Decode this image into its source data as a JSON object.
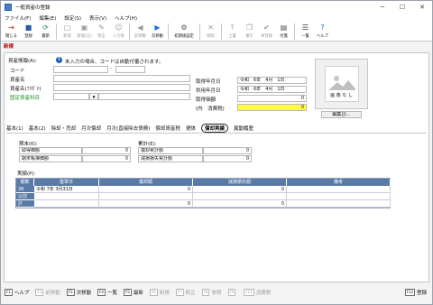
{
  "window": {
    "title": "一般資産の登録"
  },
  "menu": [
    "ファイル(F)",
    "編集(E)",
    "設定(S)",
    "表示(V)",
    "ヘルプ(H)"
  ],
  "toolbar": [
    {
      "label": "閉じる",
      "icon": "close-door-icon",
      "glyph": "⇥",
      "color": "#c0392b",
      "enabled": true
    },
    {
      "label": "登録",
      "icon": "save-icon",
      "glyph": "■",
      "color": "#2c5aa0",
      "enabled": true
    },
    {
      "label": "最新",
      "icon": "refresh-icon",
      "glyph": "⟳",
      "color": "#2e8b57",
      "enabled": true
    },
    {
      "label": "新規",
      "icon": "new-icon",
      "glyph": "▢",
      "color": "#999",
      "enabled": false
    },
    {
      "label": "新規(元)",
      "icon": "new-copy-icon",
      "glyph": "▣",
      "color": "#999",
      "enabled": false
    },
    {
      "label": "修正",
      "icon": "edit-icon",
      "glyph": "✎",
      "color": "#999",
      "enabled": false
    },
    {
      "label": "入力者",
      "icon": "user-icon",
      "glyph": "☺",
      "color": "#999",
      "enabled": false
    },
    {
      "label": "前移動",
      "icon": "prev-icon",
      "glyph": "◀",
      "color": "#999",
      "enabled": false
    },
    {
      "label": "次移動",
      "icon": "next-icon",
      "glyph": "▶",
      "color": "#1e6fd9",
      "enabled": true
    },
    {
      "label": "初期値設定",
      "icon": "defaults-icon",
      "glyph": "⚙",
      "color": "#555",
      "enabled": true
    },
    {
      "label": "削除",
      "icon": "delete-icon",
      "glyph": "✕",
      "color": "#999",
      "enabled": false
    },
    {
      "label": "上書",
      "icon": "overwrite-icon",
      "glyph": "⤒",
      "color": "#999",
      "enabled": false
    },
    {
      "label": "複写",
      "icon": "copy-icon",
      "glyph": "❐",
      "color": "#999",
      "enabled": false
    },
    {
      "label": "本登録",
      "icon": "register-icon",
      "glyph": "✔",
      "color": "#999",
      "enabled": false
    },
    {
      "label": "付箋",
      "icon": "sticky-note-icon",
      "glyph": "▤",
      "color": "#555",
      "enabled": true
    },
    {
      "label": "一覧",
      "icon": "list-icon",
      "glyph": "☰",
      "color": "#333",
      "enabled": true
    },
    {
      "label": "ヘルプ",
      "icon": "help-icon",
      "glyph": "?",
      "color": "#1e6fd9",
      "enabled": true
    }
  ],
  "mode": "新規",
  "asset_info": {
    "heading": "資産情報(A):",
    "note": "未入力の場合、コードは自動付番されます。",
    "code_label": "コード",
    "code_value": "",
    "code_sep": "-",
    "name_label": "資産名",
    "kana_label": "資産名(ﾌﾘｶﾞﾅ)",
    "account_label": "固定資産科目",
    "acquire_label": "取得年月日",
    "acquire_value": "令和　6年　4月　1日",
    "service_label": "供用年月日",
    "service_value": "令和　6年　4月　1日",
    "cost_label": "取得価額",
    "cost_value": "0",
    "tax_label": "(内　消費税)",
    "tax_value": "0",
    "photo_text": "画 像 な し",
    "photo_button": "編集(J)..."
  },
  "tabs": [
    "基本(1)",
    "基本(2)",
    "除却・売却",
    "月次償却",
    "月次(直接除去債務)",
    "償却資産税",
    "遡体",
    "償却実績",
    "異動履歴"
  ],
  "active_tab": "償却実績",
  "period": {
    "heading": "期末(K):",
    "rows": [
      {
        "label": "取得価額",
        "value": "0"
      },
      {
        "label": "期末帳簿価額",
        "value": "0"
      }
    ]
  },
  "cumulative": {
    "heading": "累計(E):",
    "rows": [
      {
        "label": "償却累計額",
        "value": "0"
      },
      {
        "label": "減損損失累計額",
        "value": "0"
      }
    ]
  },
  "results": {
    "heading": "実績(P):",
    "columns": [
      "期数",
      "基準日",
      "償却額",
      "減損損失額",
      "備考"
    ],
    "rows": [
      {
        "head": "38",
        "date": "令和 7年 3月31日",
        "dep": "0",
        "loss": "0",
        "note": ""
      },
      {
        "head": "以前",
        "date": "",
        "dep": "",
        "loss": "",
        "note": ""
      },
      {
        "head": "計",
        "date": "",
        "dep": "0",
        "loss": "0",
        "note": ""
      }
    ]
  },
  "fkeys": [
    {
      "key": "F1",
      "label": "ヘルプ",
      "enabled": true
    },
    {
      "key": "F2",
      "label": "前移動",
      "enabled": false
    },
    {
      "key": "F3",
      "label": "次移動",
      "enabled": true
    },
    {
      "key": "F4",
      "label": "一覧",
      "enabled": true
    },
    {
      "key": "F5",
      "label": "最新",
      "enabled": true
    },
    {
      "key": "F6",
      "label": "新規",
      "enabled": false
    },
    {
      "key": "F7",
      "label": "修正",
      "enabled": false
    },
    {
      "key": "F8",
      "label": "参照",
      "enabled": false
    },
    {
      "key": "F9",
      "label": "",
      "enabled": false
    },
    {
      "key": "F11",
      "label": "消費税",
      "enabled": false
    },
    {
      "key": "F12",
      "label": "登録",
      "enabled": true
    }
  ]
}
